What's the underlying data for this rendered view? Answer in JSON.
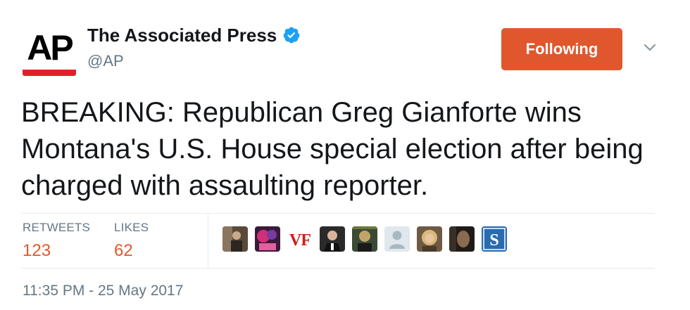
{
  "colors": {
    "accent_follow": "#e0572d",
    "ap_red": "#e22027",
    "verified_blue": "#1da1f2",
    "muted_text": "#657786",
    "divider": "#e6ecf0"
  },
  "author": {
    "avatar_text": "AP",
    "display_name": "The Associated Press",
    "handle": "@AP",
    "verified": true
  },
  "actions": {
    "follow_label": "Following",
    "menu_icon": "chevron-down-icon"
  },
  "tweet": {
    "text": "BREAKING: Republican Greg Gianforte wins Montana's U.S. House special election after being charged with assaulting reporter."
  },
  "stats": {
    "retweets_label": "RETWEETS",
    "retweets_count": "123",
    "likes_label": "LIKES",
    "likes_count": "62"
  },
  "likers": [
    {
      "name": "liker-avatar-1",
      "logo_text": ""
    },
    {
      "name": "liker-avatar-2",
      "logo_text": ""
    },
    {
      "name": "liker-avatar-3",
      "logo_text": "VF"
    },
    {
      "name": "liker-avatar-4",
      "logo_text": ""
    },
    {
      "name": "liker-avatar-5",
      "logo_text": ""
    },
    {
      "name": "liker-avatar-6",
      "logo_text": ""
    },
    {
      "name": "liker-avatar-7",
      "logo_text": ""
    },
    {
      "name": "liker-avatar-8",
      "logo_text": ""
    },
    {
      "name": "liker-avatar-9",
      "logo_text": "S"
    }
  ],
  "timestamp": "11:35 PM - 25 May 2017"
}
